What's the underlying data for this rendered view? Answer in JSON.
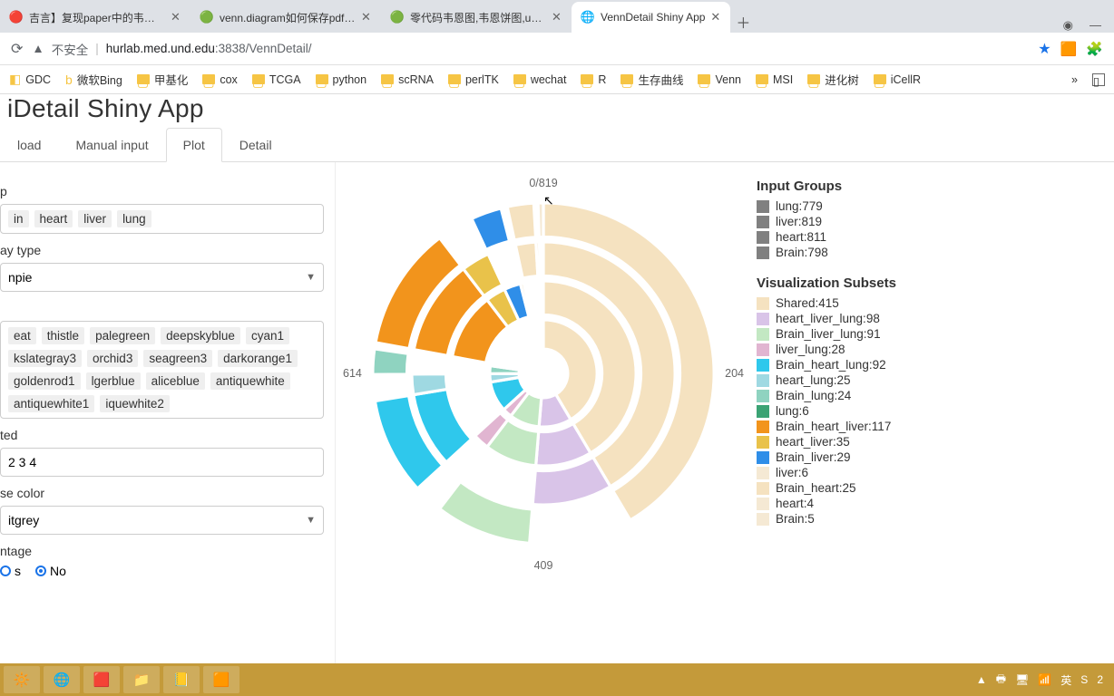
{
  "browser": {
    "tabs": [
      {
        "favicon": "🔴",
        "title": "吉言】复现paper中的韦恩图",
        "close": "✕"
      },
      {
        "favicon": "🟢",
        "title": "venn.diagram如何保存pdf格式",
        "close": "✕"
      },
      {
        "favicon": "🟢",
        "title": "零代码韦恩图,韦恩饼图,upset图",
        "close": "✕"
      },
      {
        "favicon": "🌐",
        "title": "VennDetail Shiny App",
        "close": "✕"
      }
    ],
    "new_tab": "＋",
    "window": {
      "restore": "◉",
      "min": "—"
    },
    "reload": "⟳",
    "insecure_label": "不安全",
    "url_host": "hurlab.med.und.edu",
    "url_path": ":3838/VennDetail/",
    "star": "★",
    "ext1": "🧩",
    "ext2": "🟧"
  },
  "bookmarks": [
    {
      "icon": "◧",
      "label": "GDC"
    },
    {
      "icon": "b",
      "label": "微软Bing"
    },
    {
      "icon": "📁",
      "label": "甲基化"
    },
    {
      "icon": "📁",
      "label": "cox"
    },
    {
      "icon": "📁",
      "label": "TCGA"
    },
    {
      "icon": "📁",
      "label": "python"
    },
    {
      "icon": "📁",
      "label": "scRNA"
    },
    {
      "icon": "📁",
      "label": "perlTK"
    },
    {
      "icon": "📁",
      "label": "wechat"
    },
    {
      "icon": "📁",
      "label": "R"
    },
    {
      "icon": "📁",
      "label": "生存曲线"
    },
    {
      "icon": "📁",
      "label": "Venn"
    },
    {
      "icon": "📁",
      "label": "MSI"
    },
    {
      "icon": "📁",
      "label": "进化树"
    },
    {
      "icon": "📁",
      "label": "iCellR"
    }
  ],
  "app_title": "iDetail Shiny App",
  "app_tabs": [
    {
      "label": "load",
      "active": false
    },
    {
      "label": "Manual input",
      "active": false
    },
    {
      "label": "Plot",
      "active": true
    },
    {
      "label": "Detail",
      "active": false
    }
  ],
  "sidebar": {
    "group_label": "p",
    "group_tags": [
      "in",
      "heart",
      "liver",
      "lung"
    ],
    "displaytype_label": "ay type",
    "displaytype_value": "npie",
    "colors_label": "",
    "colors_tags": [
      "eat",
      "thistle",
      "palegreen",
      "deepskyblue",
      "cyan1",
      "kslategray3",
      "orchid3",
      "seagreen3",
      "darkorange1",
      "goldenrod1",
      "lgerblue",
      "aliceblue",
      "antiquewhite",
      "antiquewhite1",
      "iquewhite2"
    ],
    "revolution_label": "ted",
    "revolution_value": "2  3  4",
    "base_color_label": "se color",
    "base_color_value": "itgrey",
    "percentage_label": "ntage",
    "radio_yes": "s",
    "radio_no": "No"
  },
  "chart_data": {
    "type": "pie",
    "title": "",
    "axis_labels": {
      "top": "0/819",
      "right": "204",
      "bottom": "409",
      "left": "614"
    },
    "input_groups_title": "Input Groups",
    "input_groups": [
      {
        "name": "lung",
        "value": 779,
        "color": "#808080"
      },
      {
        "name": "liver",
        "value": 819,
        "color": "#808080"
      },
      {
        "name": "heart",
        "value": 811,
        "color": "#808080"
      },
      {
        "name": "Brain",
        "value": 798,
        "color": "#808080"
      }
    ],
    "subsets_title": "Visualization Subsets",
    "subsets": [
      {
        "name": "Shared",
        "value": 415,
        "color": "#f5e2c0"
      },
      {
        "name": "heart_liver_lung",
        "value": 98,
        "color": "#d9c4e8"
      },
      {
        "name": "Brain_liver_lung",
        "value": 91,
        "color": "#c3e8c3"
      },
      {
        "name": "liver_lung",
        "value": 28,
        "color": "#e1b5d1"
      },
      {
        "name": "Brain_heart_lung",
        "value": 92,
        "color": "#2fc8ec"
      },
      {
        "name": "heart_lung",
        "value": 25,
        "color": "#9fd9e2"
      },
      {
        "name": "Brain_lung",
        "value": 24,
        "color": "#8fd3c0"
      },
      {
        "name": "lung",
        "value": 6,
        "color": "#3ba374"
      },
      {
        "name": "Brain_heart_liver",
        "value": 117,
        "color": "#f2941c"
      },
      {
        "name": "heart_liver",
        "value": 35,
        "color": "#e9c24a"
      },
      {
        "name": "Brain_liver",
        "value": 29,
        "color": "#2f8ee8"
      },
      {
        "name": "liver",
        "value": 6,
        "color": "#f5e9d4"
      },
      {
        "name": "Brain_heart",
        "value": 25,
        "color": "#f5e2c0"
      },
      {
        "name": "heart",
        "value": 4,
        "color": "#f5e9d4"
      },
      {
        "name": "Brain",
        "value": 5,
        "color": "#f5e9d4"
      }
    ]
  },
  "taskbar": {
    "items": [
      "🔆",
      "🌐",
      "🟥",
      "📁",
      "📒",
      "🟧"
    ],
    "tray": [
      "▲",
      "🖶",
      "🖥",
      "📶",
      "英",
      "S",
      "2"
    ]
  }
}
